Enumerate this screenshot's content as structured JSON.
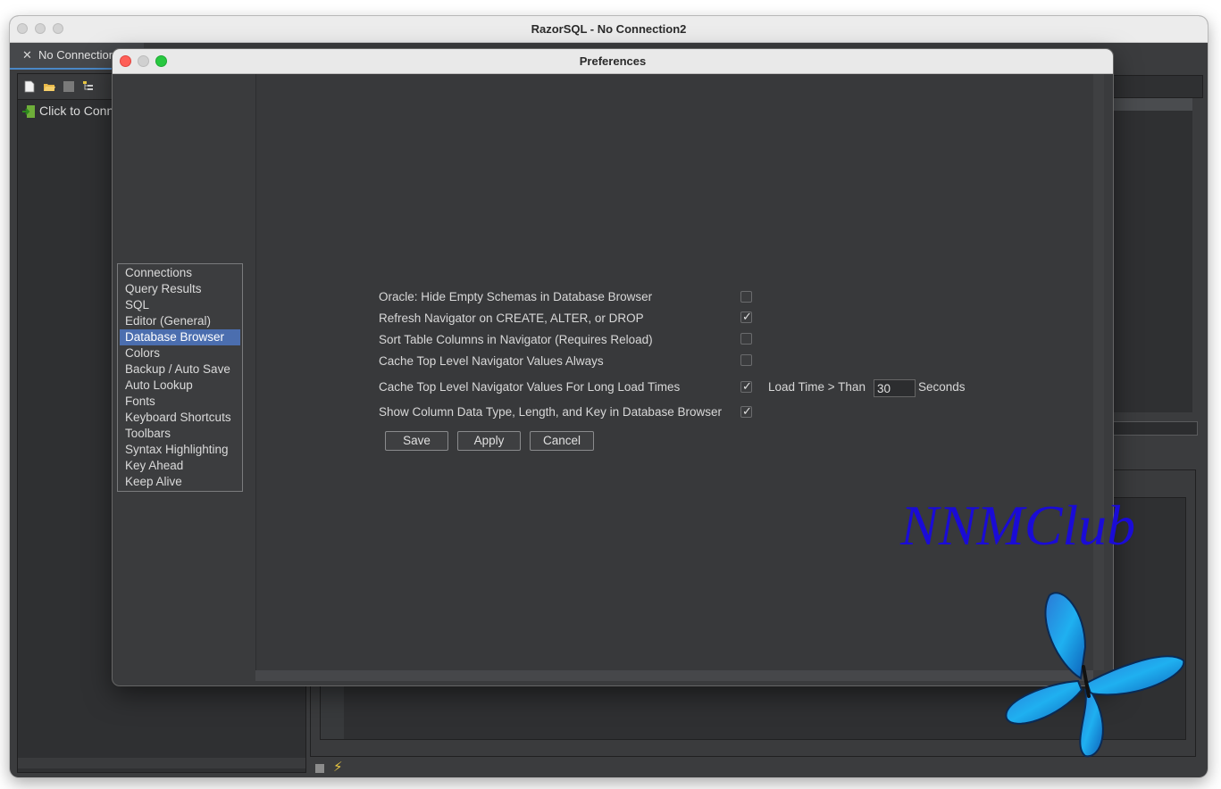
{
  "main_window": {
    "title": "RazorSQL - No Connection2",
    "tab_label": "No Connection",
    "tab_close_glyph": "✕",
    "connect_label": "Click to Connect"
  },
  "preferences": {
    "title": "Preferences",
    "categories": [
      "Connections",
      "Query Results",
      "SQL",
      "Editor (General)",
      "Database Browser",
      "Colors",
      "Backup / Auto Save",
      "Auto Lookup",
      "Fonts",
      "Keyboard Shortcuts",
      "Toolbars",
      "Syntax Highlighting",
      "Key Ahead",
      "Keep Alive"
    ],
    "selected_category": "Database Browser",
    "options": [
      {
        "label": "Oracle: Hide Empty Schemas in Database Browser",
        "checked": false
      },
      {
        "label": "Refresh Navigator on CREATE, ALTER, or DROP",
        "checked": true
      },
      {
        "label": "Sort Table Columns in Navigator (Requires Reload)",
        "checked": false
      },
      {
        "label": "Cache Top Level Navigator Values Always",
        "checked": false
      },
      {
        "label": "Cache Top Level Navigator Values For Long Load Times",
        "checked": true
      },
      {
        "label": "Show Column Data Type, Length, and Key in Database Browser",
        "checked": true
      }
    ],
    "load_time": {
      "prefix": "Load Time > Than",
      "value": "30",
      "suffix": "Seconds"
    },
    "buttons": {
      "save": "Save",
      "apply": "Apply",
      "cancel": "Cancel"
    }
  },
  "watermark": "NNMClub",
  "colors": {
    "selection": "#4b6eaf",
    "close_light": "#fe5f57",
    "minimize_light": "#d0d0d0",
    "zoom_light": "#28c840",
    "watermark": "#1a0bd6",
    "butterfly": "#1f9ae8"
  }
}
